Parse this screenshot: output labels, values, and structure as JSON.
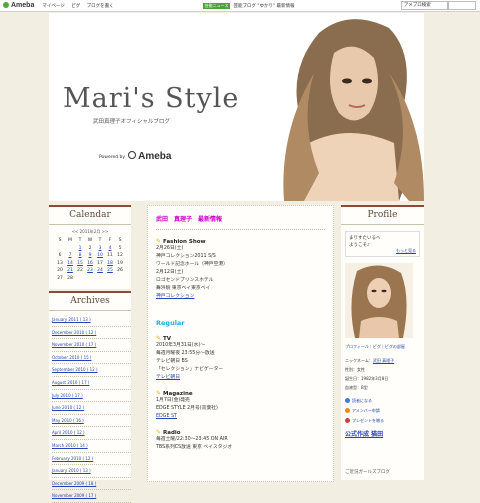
{
  "topbar": {
    "logo": "Ameba",
    "nav": [
      "マイページ",
      "ピグ",
      "ブログを書く"
    ],
    "news_tag": "芸能ニュース",
    "news_text": "芸能ブログ \"ゆかり\" 最新情報",
    "search_placeholder": "アメブロ検索"
  },
  "header": {
    "title": "Mari's Style",
    "subtitle": "武田真理子オフィシャルブログ",
    "powered_by": "Powered by",
    "powered_brand": "Ameba"
  },
  "calendar": {
    "title": "Calendar",
    "month": "<< 2011年2月 >>",
    "weekdays": [
      "S",
      "M",
      "T",
      "W",
      "T",
      "F",
      "S"
    ],
    "rows": [
      [
        "",
        "",
        "1",
        "2",
        "3",
        "4",
        "5"
      ],
      [
        "6",
        "7",
        "8",
        "9",
        "10",
        "11",
        "12"
      ],
      [
        "13",
        "14",
        "15",
        "16",
        "17",
        "18",
        "19"
      ],
      [
        "20",
        "21",
        "22",
        "23",
        "24",
        "25",
        "26"
      ],
      [
        "27",
        "28",
        "",
        "",
        "",
        "",
        ""
      ]
    ],
    "links": [
      "1",
      "3",
      "4",
      "7",
      "8",
      "9",
      "10",
      "14",
      "15",
      "16",
      "18",
      "21",
      "23",
      "24",
      "25"
    ]
  },
  "archives": {
    "title": "Archives",
    "items": [
      "January 2011 ( 13 )",
      "December 2010 ( 12 )",
      "November 2010 ( 17 )",
      "October 2010 ( 15 )",
      "September 2010 ( 12 )",
      "August 2010 ( 17 )",
      "July 2010 ( 17 )",
      "June 2010 ( 12 )",
      "May 2010 ( 16 )",
      "April 2010 ( 12 )",
      "March 2010 ( 14 )",
      "February 2010 ( 12 )",
      "January 2010 ( 13 )",
      "December 2009 ( 18 )",
      "November 2009 ( 17 )"
    ]
  },
  "main": {
    "entry_title": "武田　真理子　最新情報",
    "fashion_show": {
      "heading": "Fashion Show",
      "lines": [
        "2月26日(土)",
        "神戸コレクション2011 S/S",
        "ワールド記念ホール（神戸空港）",
        "2月12日(土)",
        "ロゴセンドプリンスホテル",
        "舞浜駅 東京ベイ東京ベイ"
      ],
      "link": "神戸コレクション"
    },
    "regular": "Regular",
    "tv": {
      "heading": "TV",
      "lines": [
        "2010年3月31日(水)～",
        "毎週月曜夜 23:55分～放送",
        "テレビ朝日 BS",
        "「セレクション」ナビゲーター"
      ],
      "link": "テレビ朝日"
    },
    "magazine": {
      "heading": "Magazine",
      "lines": [
        "1月7日(金)発売",
        "EDGE STYLE 2月号(双葉社)"
      ],
      "link": "EDGE ST"
    },
    "radio": {
      "heading": "Radio",
      "lines": [
        "毎週土曜/22:30～23:45 ON AIR",
        "TBS系列CS放送 東京 ベイスタジオ"
      ]
    }
  },
  "profile": {
    "title": "Profile",
    "intro_lines": [
      "まりすたいるへ",
      "ようこそ♪"
    ],
    "more": "もっと見る",
    "links": "プロフィール｜ピグ｜ピグの部屋",
    "info": [
      {
        "k": "ニックネーム：",
        "v": "武田 真理子"
      },
      {
        "k": "性別：",
        "v": "女性"
      },
      {
        "k": "誕生日：",
        "v": "1982年3月8日"
      },
      {
        "k": "血液型：",
        "v": "B型"
      }
    ],
    "buttons": [
      {
        "label": "読者になる",
        "color": "#3b7fd6"
      },
      {
        "label": "アメンバー申請",
        "color": "#e38a1c"
      },
      {
        "label": "プレゼントを贈る",
        "color": "#d43b3b"
      }
    ],
    "tag": "公式作成 猫田",
    "bottom": "ご近況ガールズブログ"
  }
}
